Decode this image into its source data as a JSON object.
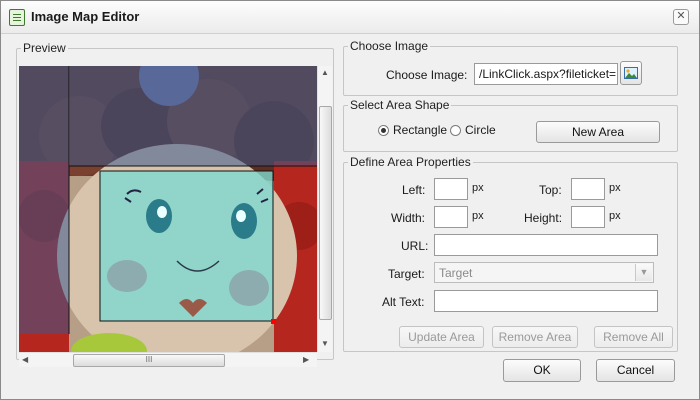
{
  "window": {
    "title": "Image Map Editor",
    "close_glyph": "✕",
    "icon": "editor-window-icon"
  },
  "preview": {
    "legend": "Preview",
    "hthumb_grip": "III",
    "scroll_up": "▲",
    "scroll_down": "▼",
    "scroll_left": "◀",
    "scroll_right": "▶"
  },
  "choose_image": {
    "legend": "Choose Image",
    "label": "Choose Image:",
    "value": "/LinkClick.aspx?fileticket=",
    "browse_icon": "image-picker-icon"
  },
  "area_shape": {
    "legend": "Select Area Shape",
    "options": [
      {
        "label": "Rectangle",
        "selected": true
      },
      {
        "label": "Circle",
        "selected": false
      }
    ],
    "new_area_label": "New Area"
  },
  "area_properties": {
    "legend": "Define Area Properties",
    "left_label": "Left:",
    "top_label": "Top:",
    "width_label": "Width:",
    "height_label": "Height:",
    "unit": "px",
    "left_value": "",
    "top_value": "",
    "width_value": "",
    "height_value": "",
    "url_label": "URL:",
    "url_value": "",
    "target_label": "Target:",
    "target_value": "Target",
    "alt_label": "Alt Text:",
    "alt_value": "",
    "update_label": "Update Area",
    "remove_label": "Remove Area",
    "remove_all_label": "Remove All"
  },
  "footer": {
    "ok_label": "OK",
    "cancel_label": "Cancel"
  },
  "colors": {
    "selection_fill": "#7fd8cf",
    "overlay": "#3c5a8c",
    "handle": "#ff0000"
  }
}
